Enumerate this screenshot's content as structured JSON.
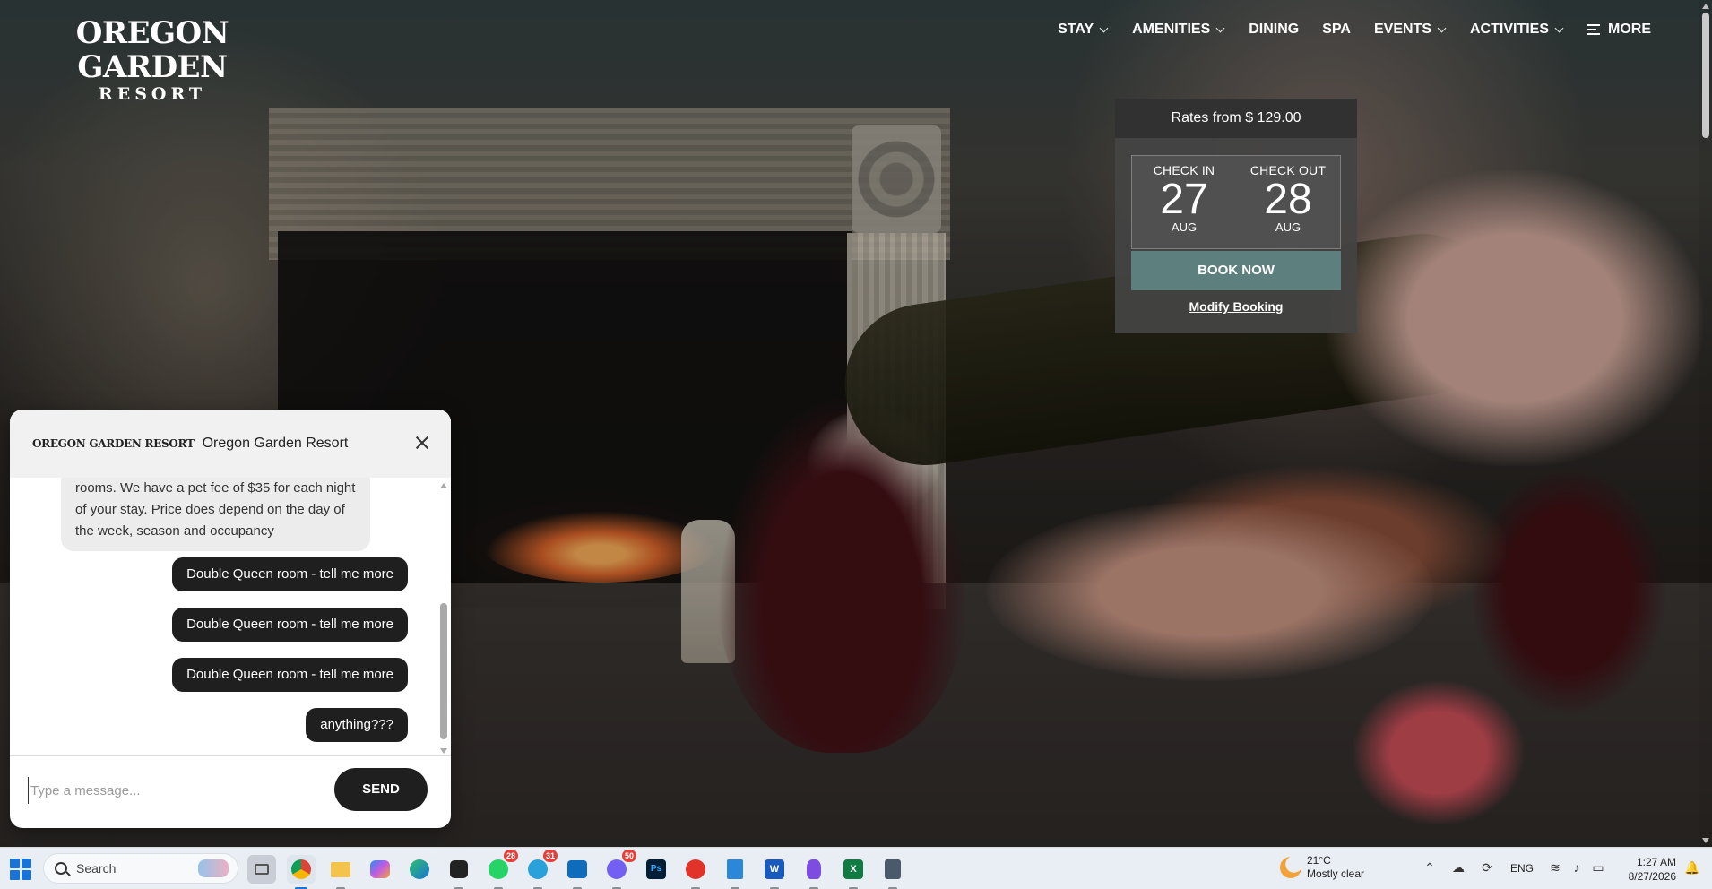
{
  "site": {
    "logo_line1": "OREGON GARDEN",
    "logo_line2": "RESORT"
  },
  "nav": {
    "items": [
      {
        "label": "STAY",
        "dropdown": true
      },
      {
        "label": "AMENITIES",
        "dropdown": true
      },
      {
        "label": "DINING",
        "dropdown": false
      },
      {
        "label": "SPA",
        "dropdown": false
      },
      {
        "label": "EVENTS",
        "dropdown": true
      },
      {
        "label": "ACTIVITIES",
        "dropdown": true
      }
    ],
    "more_label": "MORE",
    "more_icon": "menu-icon"
  },
  "booking": {
    "rates_text": "Rates from $ 129.00",
    "check_in_label": "CHECK IN",
    "check_in_day": "27",
    "check_in_month": "AUG",
    "check_out_label": "CHECK OUT",
    "check_out_day": "28",
    "check_out_month": "AUG",
    "book_label": "BOOK NOW",
    "modify_label": "Modify Booking",
    "accent_color": "#5d7f7d"
  },
  "chat": {
    "logo_text": "OREGON GARDEN RESORT",
    "title": "Oregon Garden Resort",
    "bot_message": "rooms. We have a pet fee of $35 for each night of your stay. Price does depend on the day of the week, season and occupancy",
    "user_messages": [
      "Double Queen room - tell me more",
      "Double Queen room - tell me more",
      "Double Queen room - tell me more",
      "anything???"
    ],
    "input_placeholder": "Type a message...",
    "send_label": "SEND"
  },
  "taskbar": {
    "search_label": "Search",
    "apps": [
      {
        "name": "task-view",
        "badge": ""
      },
      {
        "name": "chrome",
        "badge": ""
      },
      {
        "name": "file-explorer",
        "badge": ""
      },
      {
        "name": "copilot",
        "badge": ""
      },
      {
        "name": "edge",
        "badge": ""
      },
      {
        "name": "app-dark",
        "badge": ""
      },
      {
        "name": "whatsapp",
        "badge": "28"
      },
      {
        "name": "telegram",
        "badge": "31"
      },
      {
        "name": "outlook",
        "badge": ""
      },
      {
        "name": "viber",
        "badge": "50"
      },
      {
        "name": "photoshop",
        "badge": ""
      },
      {
        "name": "pdf-reader",
        "badge": ""
      },
      {
        "name": "notepad",
        "badge": ""
      },
      {
        "name": "word",
        "badge": ""
      },
      {
        "name": "obsidian",
        "badge": ""
      },
      {
        "name": "excel",
        "badge": ""
      },
      {
        "name": "calculator",
        "badge": ""
      }
    ],
    "weather_temp": "21°C",
    "weather_desc": "Mostly clear",
    "language": "ENG",
    "time": "1:27 AM",
    "date": "8/27/2026"
  }
}
